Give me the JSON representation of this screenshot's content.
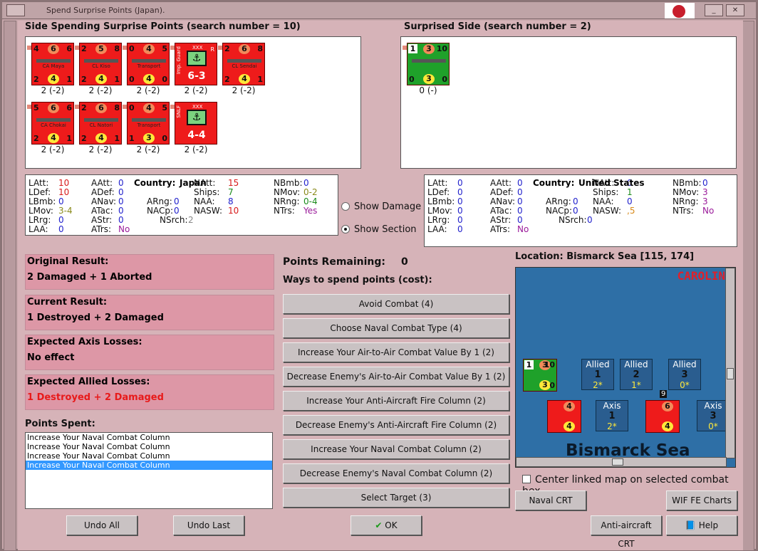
{
  "window": {
    "title": "Spend Surprise Points (Japan)."
  },
  "attacker": {
    "heading": "Side Spending Surprise Points (search number = 10)",
    "units": [
      {
        "type": "ship",
        "name": "CA Maya",
        "tl": "4",
        "tc": "6",
        "tr": "6",
        "bl": "2",
        "bc": "4",
        "br": "1",
        "tag": "2 (-2)"
      },
      {
        "type": "ship",
        "name": "CL Kiso",
        "tl": "2",
        "tc": "5",
        "tr": "8",
        "bl": "2",
        "bc": "4",
        "br": "1",
        "tag": "2 (-2)"
      },
      {
        "type": "ship",
        "name": "Transport",
        "tl": "0",
        "tc": "4",
        "tr": "5",
        "bl": "0",
        "bc": "4",
        "br": "0",
        "tag": "2 (-2)"
      },
      {
        "type": "land",
        "side": "Imp. Guard",
        "xxx": "XXX",
        "r": "R",
        "val": "6-3",
        "tag": "2 (-2)"
      },
      {
        "type": "ship",
        "name": "CL Sendai",
        "tl": "2",
        "tc": "6",
        "tr": "8",
        "bl": "2",
        "bc": "4",
        "br": "1",
        "tag": "2 (-2)"
      },
      {
        "type": "ship",
        "name": "CA Chokai",
        "tl": "5",
        "tc": "6",
        "tr": "6",
        "bl": "2",
        "bc": "4",
        "br": "1",
        "tag": "2 (-2)"
      },
      {
        "type": "ship",
        "name": "CL Natori",
        "tl": "2",
        "tc": "6",
        "tr": "8",
        "bl": "2",
        "bc": "4",
        "br": "1",
        "tag": "2 (-2)"
      },
      {
        "type": "ship",
        "name": "Transport",
        "tl": "0",
        "tc": "4",
        "tr": "5",
        "bl": "1",
        "bc": "3",
        "br": "0",
        "tag": "2 (-2)"
      },
      {
        "type": "land",
        "side": "SNLF",
        "xxx": "XXX",
        "r": "",
        "val": "4-4",
        "tag": "2 (-2)"
      }
    ]
  },
  "defender": {
    "heading": "Surprised Side (search number = 2)",
    "units": [
      {
        "type": "ship",
        "name": "",
        "tl": "1",
        "tc": "3",
        "tr": "10",
        "bl": "0",
        "bc": "3",
        "br": "0",
        "tag": "0 (-)"
      }
    ]
  },
  "stats_left": {
    "country_label": "Country:",
    "country": "Japan",
    "rows": [
      [
        "LAtt:",
        "10",
        "AAtt:",
        "0",
        "NAtt:",
        "15",
        "NBmb:",
        "0"
      ],
      [
        "LDef:",
        "10",
        "ADef:",
        "0",
        "Ships:",
        "7",
        "NMov:",
        "0-2"
      ],
      [
        "LBmb:",
        "0",
        "ANav:",
        "0",
        "ARng:",
        "0",
        "NAA:",
        "8",
        "NRng:",
        "0-4"
      ],
      [
        "LMov:",
        "3-4",
        "ATac:",
        "0",
        "NACp:",
        "0",
        "NASW:",
        "10",
        "NTrs:",
        "Yes"
      ],
      [
        "LRrg:",
        "0",
        "AStr:",
        "0",
        "NSrch:",
        "2"
      ],
      [
        "LAA:",
        "0",
        "ATrs:",
        "No"
      ]
    ]
  },
  "stats_right": {
    "country_label": "Country:",
    "country": "United States",
    "rows": [
      [
        "LAtt:",
        "0",
        "AAtt:",
        "0",
        "NAtt:",
        "0",
        "NBmb:",
        "0"
      ],
      [
        "LDef:",
        "0",
        "ADef:",
        "0",
        "Ships:",
        "1",
        "NMov:",
        "3"
      ],
      [
        "LBmb:",
        "0",
        "ANav:",
        "0",
        "ARng:",
        "0",
        "NAA:",
        "0",
        "NRng:",
        "3"
      ],
      [
        "LMov:",
        "0",
        "ATac:",
        "0",
        "NACp:",
        "0",
        "NASW:",
        ",5",
        "NTrs:",
        "No"
      ],
      [
        "LRrg:",
        "0",
        "AStr:",
        "0",
        "NSrch:",
        "0"
      ],
      [
        "LAA:",
        "0",
        "ATrs:",
        "No"
      ]
    ]
  },
  "options": {
    "show_damage": "Show Damage",
    "show_section": "Show Section"
  },
  "results": {
    "original_label": "Original Result:",
    "original": "2 Damaged + 1 Aborted",
    "current_label": "Current Result:",
    "current": "1 Destroyed + 2 Damaged",
    "axis_label": "Expected Axis Losses:",
    "axis": "No effect",
    "allied_label": "Expected Allied Losses:",
    "allied": "1 Destroyed + 2 Damaged"
  },
  "points": {
    "remaining_label": "Points Remaining:",
    "remaining": "0",
    "ways_label": "Ways to spend points (cost):",
    "spent_label": "Points Spent:",
    "spent": [
      "Increase Your Naval Combat Column",
      "Increase Your Naval Combat Column",
      "Increase Your Naval Combat Column",
      "Increase Your Naval Combat Column"
    ]
  },
  "actions": [
    "Avoid Combat (4)",
    "Choose Naval Combat Type (4)",
    "Increase Your Air-to-Air Combat Value By 1 (2)",
    "Decrease Enemy's Air-to-Air Combat Value By 1 (2)",
    "Increase Your Anti-Aircraft Fire Column (2)",
    "Decrease Enemy's Anti-Aircraft Fire Column (2)",
    "Increase Your Naval Combat Column (2)",
    "Decrease Enemy's Naval Combat Column (2)",
    "Select Target (3)"
  ],
  "map": {
    "location": "Location: Bismarck Sea [115, 174]",
    "region": "CAROLIN",
    "sea": "Bismarck Sea",
    "boxes": [
      {
        "side": "Allied",
        "num": "1",
        "val": "2*"
      },
      {
        "side": "Allied",
        "num": "2",
        "val": "1*"
      },
      {
        "side": "Allied",
        "num": "3",
        "val": "0*"
      },
      {
        "side": "Axis",
        "num": "1",
        "val": "2*"
      },
      {
        "side": "Axis",
        "num": "3",
        "val": "0*"
      }
    ],
    "stack_count": "9",
    "center_link": "Center linked map on selected combat hex"
  },
  "buttons": {
    "undo_all": "Undo All",
    "undo_last": "Undo Last",
    "ok": "OK",
    "naval_crt": "Naval CRT",
    "wif_charts": "WIF FE Charts",
    "aa_crt": "Anti-aircraft CRT",
    "help": "Help"
  }
}
